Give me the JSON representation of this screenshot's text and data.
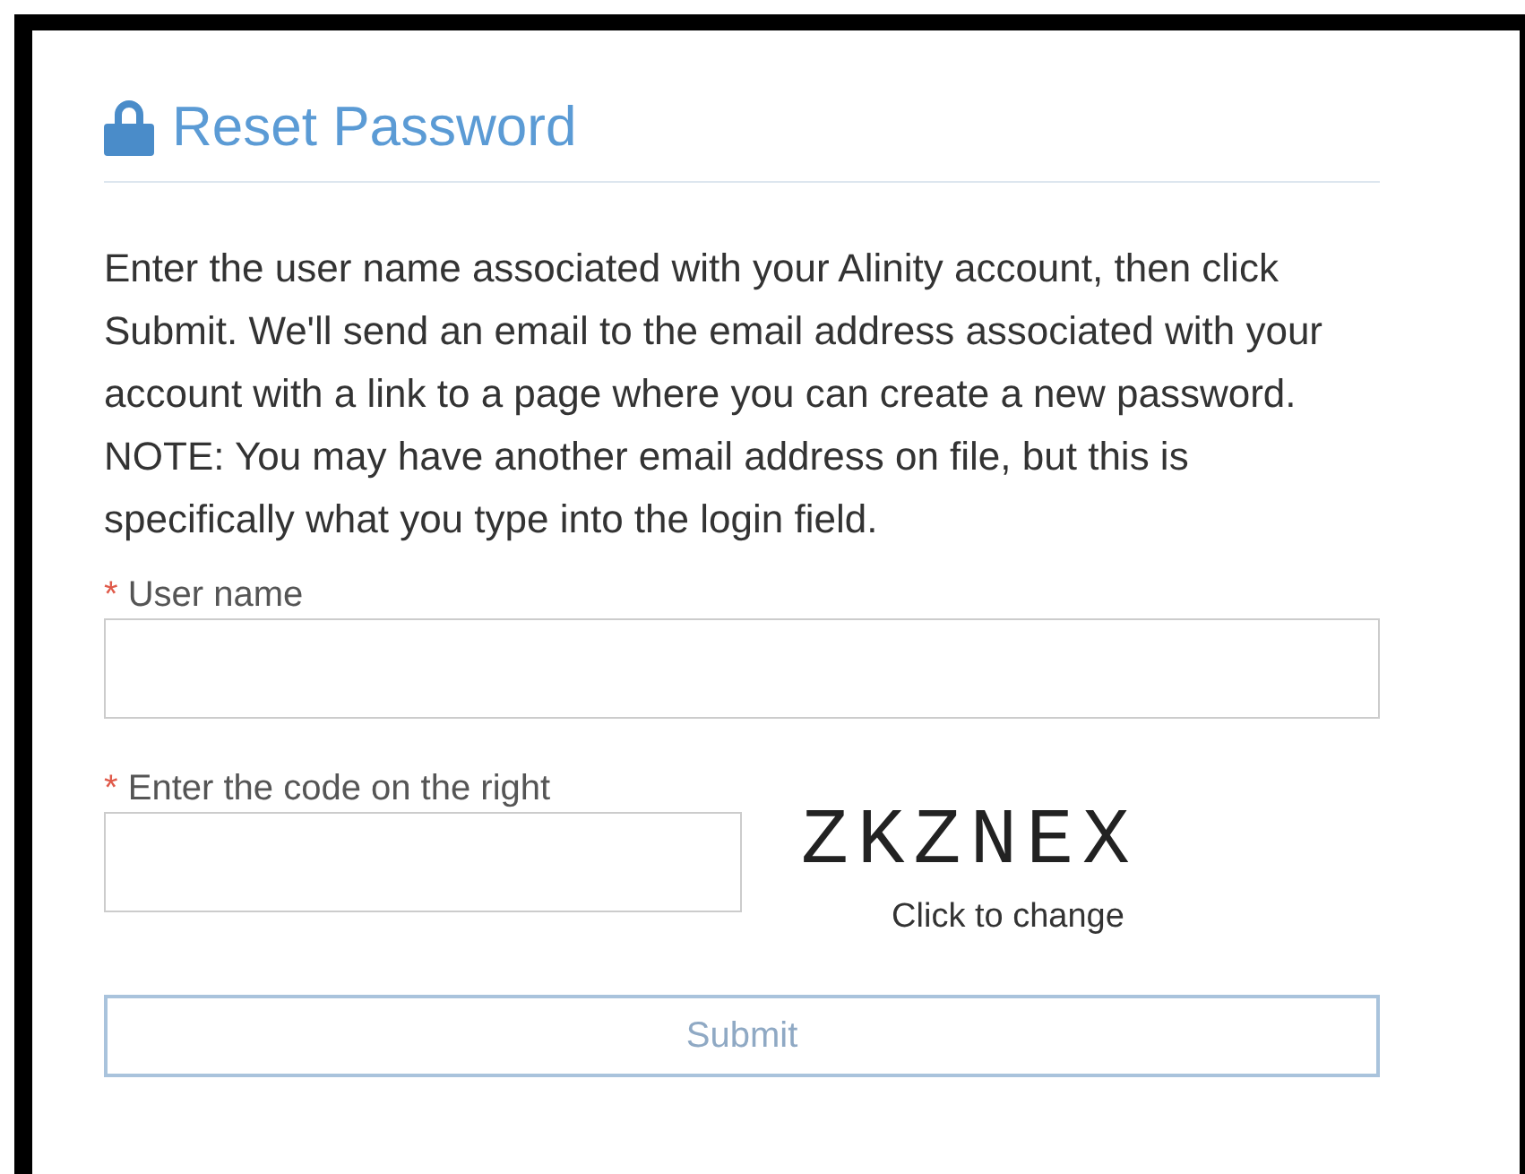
{
  "title": "Reset Password",
  "paragraphs": [
    "Enter the user name associated with your Alinity account, then click Submit. We'll send an email to the email address associated with your account with a link to a page where you can create a new password.",
    "NOTE: You may have another email address on file, but this is specifically what you type into the login field."
  ],
  "fields": [
    {
      "marker": "*",
      "label": "User name"
    },
    {
      "marker": "*",
      "label": "Enter the code on the right"
    }
  ],
  "captcha": {
    "code": "ZKZNEX",
    "link": "Click to change"
  },
  "submit": {
    "label": "Submit",
    "disabled": true
  }
}
